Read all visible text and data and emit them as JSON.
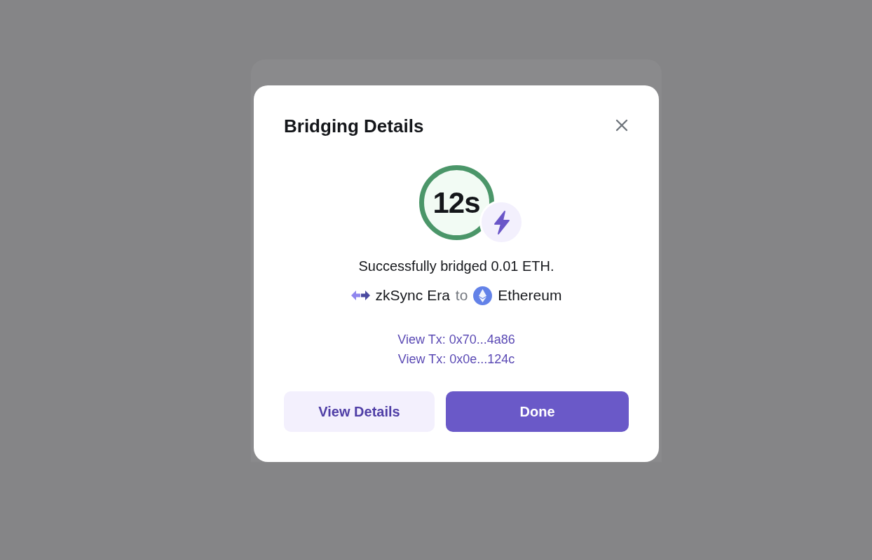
{
  "dialog": {
    "title": "Bridging Details"
  },
  "timer": {
    "text": "12s"
  },
  "message": "Successfully bridged 0.01 ETH.",
  "route": {
    "from": "zkSync Era",
    "connector": "to",
    "to": "Ethereum"
  },
  "tx_links": [
    "View Tx: 0x70...4a86",
    "View Tx: 0x0e...124c"
  ],
  "buttons": [
    {
      "label": "View Details",
      "kind": "secondary"
    },
    {
      "label": "Done",
      "kind": "primary"
    }
  ]
}
